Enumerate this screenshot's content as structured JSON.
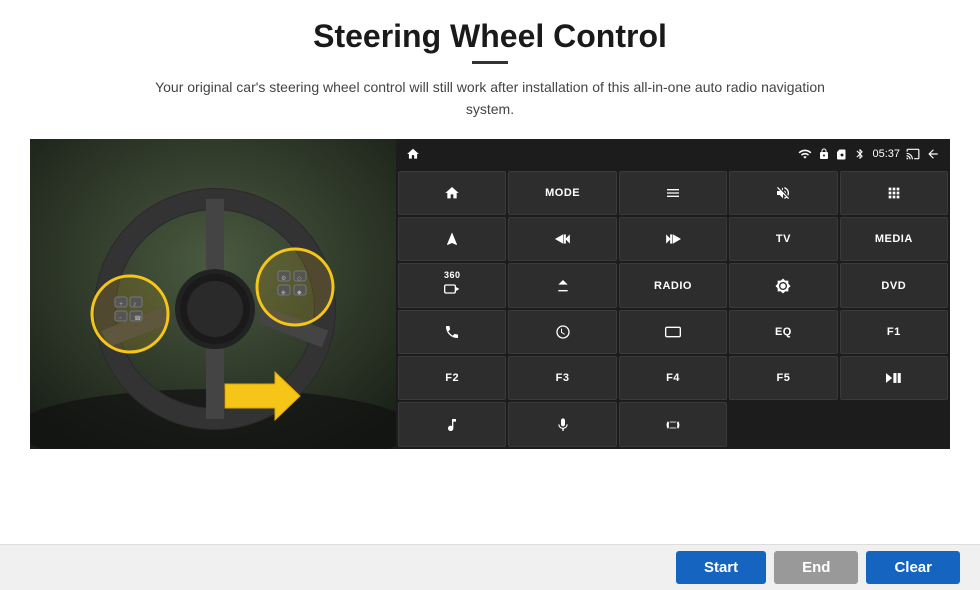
{
  "page": {
    "title": "Steering Wheel Control",
    "subtitle": "Your original car's steering wheel control will still work after installation of this all-in-one auto radio navigation system.",
    "divider_color": "#333"
  },
  "status_bar": {
    "time": "05:37",
    "icons": [
      "wifi",
      "lock",
      "sim",
      "bluetooth",
      "cast",
      "back"
    ]
  },
  "grid_buttons": [
    {
      "label": "home",
      "type": "icon",
      "row": 1,
      "col": 1
    },
    {
      "label": "MODE",
      "type": "text",
      "row": 1,
      "col": 2
    },
    {
      "label": "menu",
      "type": "icon",
      "row": 1,
      "col": 3
    },
    {
      "label": "mute",
      "type": "icon",
      "row": 1,
      "col": 4
    },
    {
      "label": "apps",
      "type": "icon",
      "row": 1,
      "col": 5
    },
    {
      "label": "navigate",
      "type": "icon",
      "row": 2,
      "col": 1
    },
    {
      "label": "prev",
      "type": "icon",
      "row": 2,
      "col": 2
    },
    {
      "label": "next",
      "type": "icon",
      "row": 2,
      "col": 3
    },
    {
      "label": "TV",
      "type": "text",
      "row": 2,
      "col": 4
    },
    {
      "label": "MEDIA",
      "type": "text",
      "row": 2,
      "col": 5
    },
    {
      "label": "360cam",
      "type": "icon",
      "row": 3,
      "col": 1
    },
    {
      "label": "eject",
      "type": "icon",
      "row": 3,
      "col": 2
    },
    {
      "label": "RADIO",
      "type": "text",
      "row": 3,
      "col": 3
    },
    {
      "label": "brightness",
      "type": "icon",
      "row": 3,
      "col": 4
    },
    {
      "label": "DVD",
      "type": "text",
      "row": 3,
      "col": 5
    },
    {
      "label": "phone",
      "type": "icon",
      "row": 4,
      "col": 1
    },
    {
      "label": "swipe",
      "type": "icon",
      "row": 4,
      "col": 2
    },
    {
      "label": "screen",
      "type": "icon",
      "row": 4,
      "col": 3
    },
    {
      "label": "EQ",
      "type": "text",
      "row": 4,
      "col": 4
    },
    {
      "label": "F1",
      "type": "text",
      "row": 4,
      "col": 5
    },
    {
      "label": "F2",
      "type": "text",
      "row": 5,
      "col": 1
    },
    {
      "label": "F3",
      "type": "text",
      "row": 5,
      "col": 2
    },
    {
      "label": "F4",
      "type": "text",
      "row": 5,
      "col": 3
    },
    {
      "label": "F5",
      "type": "text",
      "row": 5,
      "col": 4
    },
    {
      "label": "playpause",
      "type": "icon",
      "row": 5,
      "col": 5
    },
    {
      "label": "music",
      "type": "icon",
      "row": 6,
      "col": 1
    },
    {
      "label": "mic",
      "type": "icon",
      "row": 6,
      "col": 2
    },
    {
      "label": "call",
      "type": "icon",
      "row": 6,
      "col": 3
    },
    {
      "label": "",
      "type": "empty",
      "row": 6,
      "col": 4
    },
    {
      "label": "",
      "type": "empty",
      "row": 6,
      "col": 5
    }
  ],
  "bottom_bar": {
    "start_label": "Start",
    "end_label": "End",
    "clear_label": "Clear"
  }
}
